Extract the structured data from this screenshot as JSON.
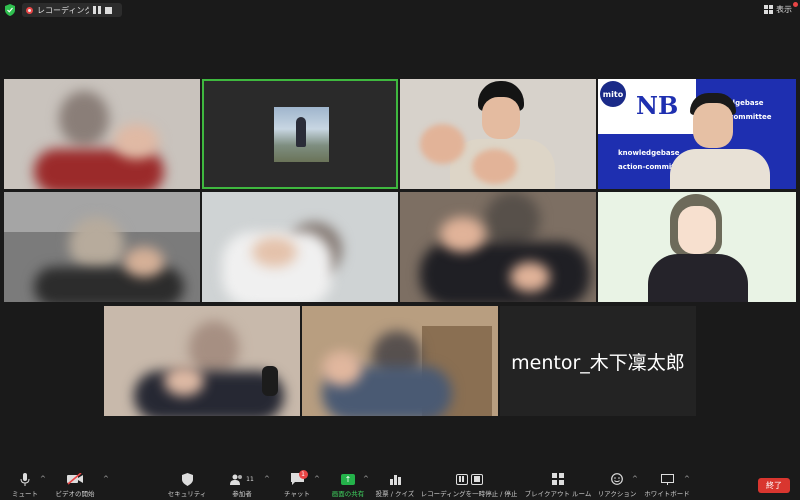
{
  "topbar": {
    "recording_label": "レコーディング中...",
    "view_label": "表示"
  },
  "tiles": {
    "mentor_name": "mentor_木下凜太郎",
    "nb_logo": {
      "mito": "mito",
      "line1": "knowledgebase",
      "line2": "action-committee",
      "line3": "knowledgebase",
      "line4": "action-committee"
    }
  },
  "toolbar": {
    "mute": "ミュート",
    "video_start": "ビデオの開始",
    "security": "セキュリティ",
    "participants": "参加者",
    "participants_count": "11",
    "chat": "チャット",
    "chat_badge": "1",
    "share": "画面の共有",
    "polls": "投票 / クイズ",
    "recording_pause": "レコーディングを一時停止 / 停止",
    "breakout": "ブレイクアウト ルーム",
    "reactions": "リアクション",
    "whiteboard": "ホワイトボード",
    "end": "終了"
  },
  "colors": {
    "accent_green": "#3fb83f",
    "end_red": "#d9362f",
    "nb_blue": "#1e2fb0"
  }
}
